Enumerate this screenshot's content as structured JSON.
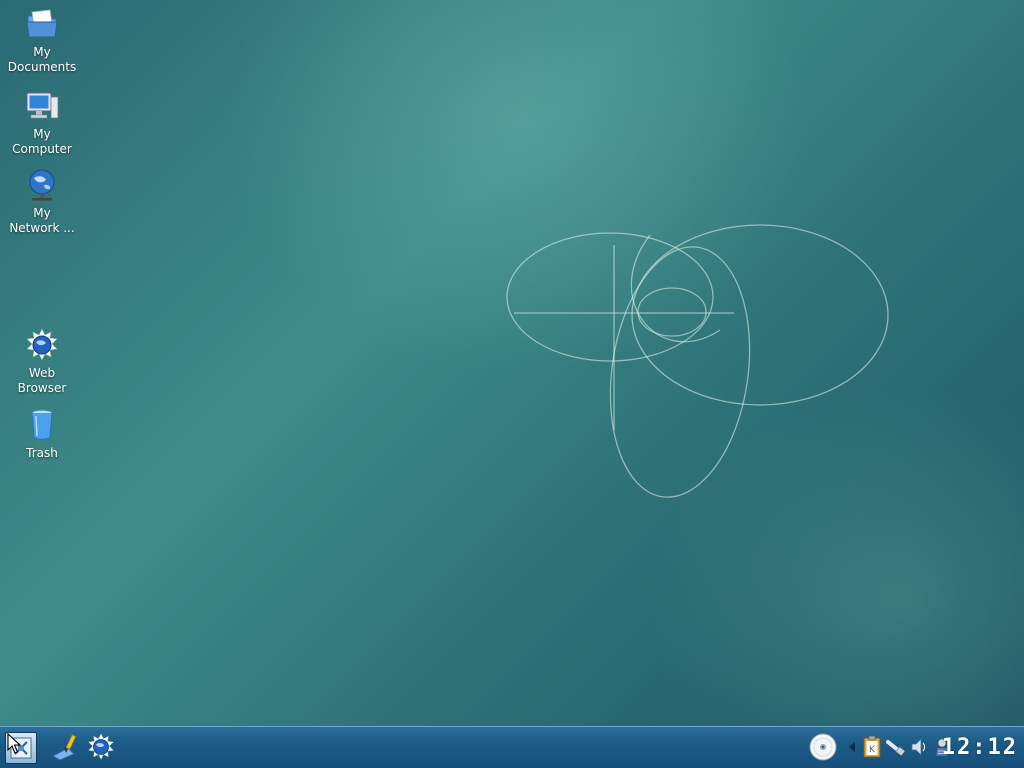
{
  "desktop": {
    "icons": [
      {
        "label": "My\nDocuments",
        "icon": "folder-icon"
      },
      {
        "label": "My\nComputer",
        "icon": "computer-icon"
      },
      {
        "label": "My\nNetwork ...",
        "icon": "network-icon"
      },
      {
        "label": "Web\nBrowser",
        "icon": "web-browser-icon"
      },
      {
        "label": "Trash",
        "icon": "trash-icon"
      }
    ]
  },
  "taskbar": {
    "launchers": [
      {
        "name": "kmenu",
        "icon": "kde-menu-icon"
      },
      {
        "name": "desktop-editor",
        "icon": "paint-brush-icon"
      },
      {
        "name": "konqueror",
        "icon": "gear-globe-icon"
      }
    ],
    "tray": [
      {
        "name": "cd-drive",
        "icon": "cd-icon"
      },
      {
        "name": "tray-expand",
        "icon": "arrow-left-icon"
      },
      {
        "name": "klipper",
        "icon": "clipboard-icon"
      },
      {
        "name": "network",
        "icon": "network-cable-icon"
      },
      {
        "name": "volume",
        "icon": "speaker-icon"
      },
      {
        "name": "updater",
        "icon": "updater-icon"
      }
    ],
    "clock": "12:12"
  },
  "colors": {
    "desktop_accent": "#3f8c8a",
    "taskbar": "#1c5b86"
  }
}
